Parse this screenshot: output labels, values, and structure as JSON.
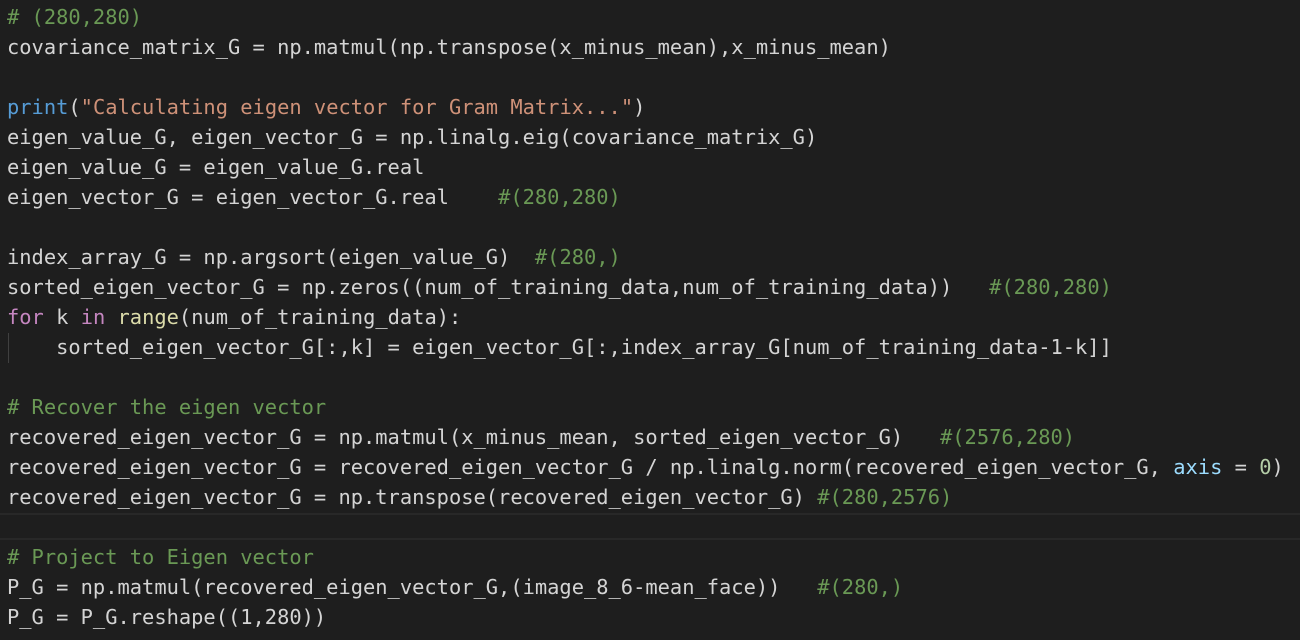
{
  "editor": {
    "lines": [
      [
        {
          "t": "# (280,280)",
          "c": "c"
        }
      ],
      [
        {
          "t": "covariance_matrix_G = np.matmul(np.transpose(x_minus_mean),x_minus_mean)",
          "c": "t"
        }
      ],
      [],
      [
        {
          "t": "print",
          "c": "k"
        },
        {
          "t": "(",
          "c": "t"
        },
        {
          "t": "\"Calculating eigen vector for Gram Matrix...\"",
          "c": "s"
        },
        {
          "t": ")",
          "c": "t"
        }
      ],
      [
        {
          "t": "eigen_value_G, eigen_vector_G = np.linalg.eig(covariance_matrix_G)",
          "c": "t"
        }
      ],
      [
        {
          "t": "eigen_value_G = eigen_value_G.real",
          "c": "t"
        }
      ],
      [
        {
          "t": "eigen_vector_G = eigen_vector_G.real    ",
          "c": "t"
        },
        {
          "t": "#(280,280)",
          "c": "c"
        }
      ],
      [],
      [
        {
          "t": "index_array_G = np.argsort(eigen_value_G)  ",
          "c": "t"
        },
        {
          "t": "#(280,)",
          "c": "c"
        }
      ],
      [
        {
          "t": "sorted_eigen_vector_G = np.zeros((num_of_training_data,num_of_training_data))   ",
          "c": "t"
        },
        {
          "t": "#(280,280)",
          "c": "c"
        }
      ],
      [
        {
          "t": "for",
          "c": "kc"
        },
        {
          "t": " k ",
          "c": "t"
        },
        {
          "t": "in",
          "c": "kc"
        },
        {
          "t": " ",
          "c": "t"
        },
        {
          "t": "range",
          "c": "f"
        },
        {
          "t": "(num_of_training_data):",
          "c": "t"
        }
      ],
      [
        {
          "t": "    sorted_eigen_vector_G[:,k] = eigen_vector_G[:,index_array_G[num_of_training_data-1-k]]",
          "c": "t"
        }
      ],
      [],
      [
        {
          "t": "# Recover the eigen vector",
          "c": "c"
        }
      ],
      [
        {
          "t": "recovered_eigen_vector_G = np.matmul(x_minus_mean, sorted_eigen_vector_G)   ",
          "c": "t"
        },
        {
          "t": "#(2576,280)",
          "c": "c"
        }
      ],
      [
        {
          "t": "recovered_eigen_vector_G = recovered_eigen_vector_G / np.linalg.norm(recovered_eigen_vector_G, ",
          "c": "t"
        },
        {
          "t": "axis",
          "c": "p"
        },
        {
          "t": " = ",
          "c": "t"
        },
        {
          "t": "0",
          "c": "n"
        },
        {
          "t": ")",
          "c": "t"
        }
      ],
      [
        {
          "t": "recovered_eigen_vector_G = np.transpose(recovered_eigen_vector_G) ",
          "c": "t"
        },
        {
          "t": "#(280,2576)",
          "c": "c"
        }
      ],
      [],
      [
        {
          "t": "# Project to Eigen vector",
          "c": "c"
        }
      ],
      [
        {
          "t": "P_G = np.matmul(recovered_eigen_vector_G,(image_8_6-mean_face))   ",
          "c": "t"
        },
        {
          "t": "#(280,)",
          "c": "c"
        }
      ],
      [
        {
          "t": "P_G = P_G.reshape((1,280))",
          "c": "t"
        }
      ]
    ]
  }
}
